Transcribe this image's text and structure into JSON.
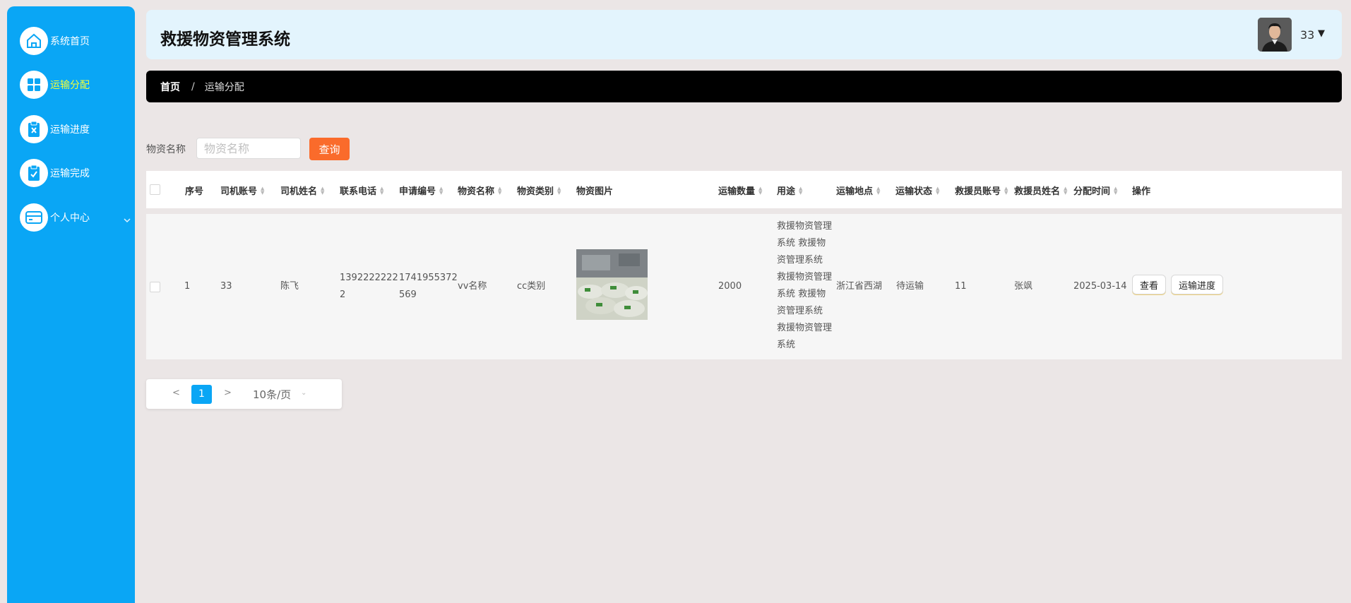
{
  "sidebar": {
    "items": [
      {
        "label": "系统首页",
        "icon": "home-icon"
      },
      {
        "label": "运输分配",
        "icon": "grid-icon"
      },
      {
        "label": "运输进度",
        "icon": "clipboard-x-icon"
      },
      {
        "label": "运输完成",
        "icon": "clipboard-check-icon"
      },
      {
        "label": "个人中心",
        "icon": "card-icon"
      }
    ]
  },
  "header": {
    "title": "救援物资管理系统",
    "user_name": "33",
    "user_caret": "▼"
  },
  "breadcrumb": {
    "home": "首页",
    "separator": "/",
    "current": "运输分配"
  },
  "search": {
    "label": "物资名称",
    "placeholder": "物资名称",
    "button": "查询"
  },
  "table": {
    "columns": [
      "序号",
      "司机账号",
      "司机姓名",
      "联系电话",
      "申请编号",
      "物资名称",
      "物资类别",
      "物资图片",
      "运输数量",
      "用途",
      "运输地点",
      "运输状态",
      "救援员账号",
      "救援员姓名",
      "分配时间",
      "操作"
    ],
    "rows": [
      {
        "index": "1",
        "driver_account": "33",
        "driver_name": "陈飞",
        "phone_lines": [
          "1392222222",
          "2"
        ],
        "apply_no_lines": [
          "1741955372",
          "569"
        ],
        "material_name": "vv名称",
        "material_type": "cc类别",
        "quantity": "2000",
        "purpose_lines": [
          "救援物资管理",
          "系统 救援物",
          "资管理系统",
          "救援物资管理",
          "系统 救援物",
          "资管理系统",
          "救援物资管理",
          "系统"
        ],
        "location": "浙江省西湖",
        "status": "待运输",
        "rescuer_account": "11",
        "rescuer_name": "张飒",
        "assign_time": "2025-03-14",
        "actions": [
          "查看",
          "运输进度"
        ]
      }
    ]
  },
  "pagination": {
    "prev": "<",
    "current": "1",
    "next": ">",
    "page_size": "10条/页"
  },
  "colors": {
    "sidebar_bg": "#0aa6f5",
    "active_label": "#f0ff3a",
    "search_button": "#fa6b2b",
    "header_bg": "#e3f4fd",
    "breadcrumb_bg": "#000000"
  }
}
